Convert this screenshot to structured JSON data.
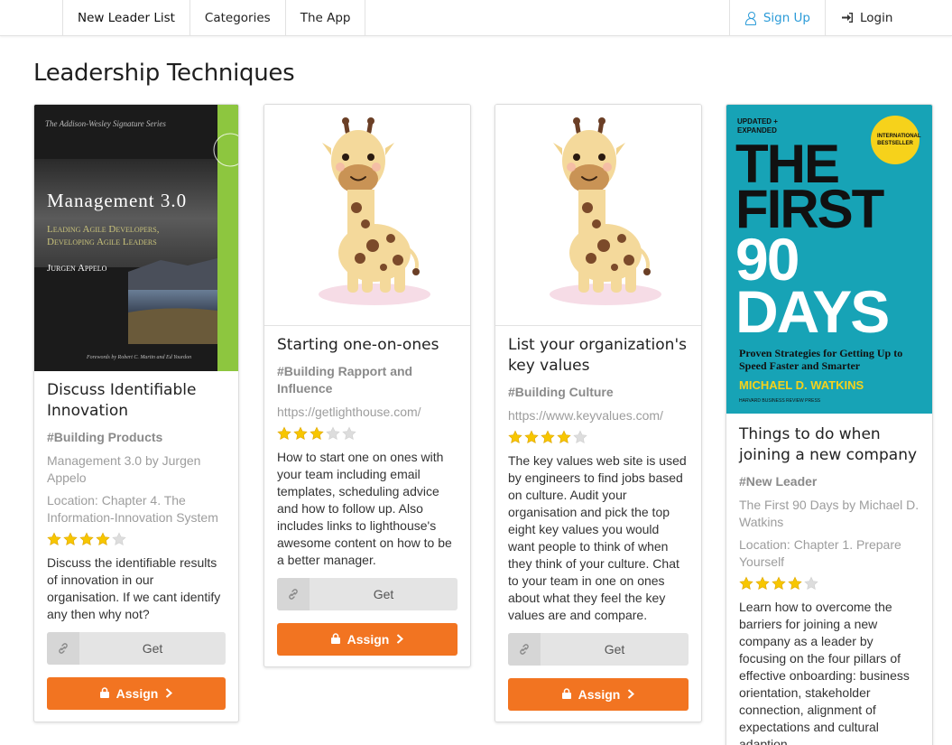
{
  "nav": {
    "items": [
      {
        "label": "New Leader List"
      },
      {
        "label": "Categories"
      },
      {
        "label": "The App"
      }
    ],
    "signup": "Sign Up",
    "login": "Login"
  },
  "page": {
    "title": "Leadership Techniques"
  },
  "cards": [
    {
      "title": "Discuss Identifiable Innovation",
      "tag": "#Building Products",
      "source": "Management 3.0  by Jurgen Appelo",
      "location": "Location: Chapter 4. The Information-Innovation System",
      "rating": 4,
      "description": "Discuss the identifiable results of innovation in our organisation. If we cant identify any then why not?",
      "get_label": "Get",
      "assign_label": "Assign",
      "cover": {
        "series": "The Addison-Wesley Signature Series",
        "title": "Management 3.0",
        "subtitle_line1": "Leading Agile Developers,",
        "subtitle_line2": "Developing Agile Leaders",
        "author": "Jurgen Appelo",
        "foreword": "Forewords by Robert C. Martin and Ed Yourdon",
        "color_bg": "#1b1b1b",
        "color_accent": "#8dc63f"
      }
    },
    {
      "title": "Starting one-on-ones",
      "tag": "#Building Rapport and Influence",
      "url": "https://getlighthouse.com/",
      "rating": 3,
      "description": "How to start one on ones with your team including email templates, scheduling advice and how to follow up. Also includes links to lighthouse's awesome content on how to be a better manager.",
      "get_label": "Get",
      "assign_label": "Assign"
    },
    {
      "title": "List your organization's key values",
      "tag": "#Building Culture",
      "url": "https://www.keyvalues.com/",
      "rating": 4,
      "description": "The key values web site is used by engineers to find jobs based on culture. Audit your organisation and pick the top eight key values you would want people to think of when they think of your culture. Chat to your team in one on ones about what they feel the key values are and compare.",
      "get_label": "Get",
      "assign_label": "Assign"
    },
    {
      "title": "Things to do when joining a new company",
      "tag": "#New Leader",
      "source": "The First 90 Days  by Michael D. Watkins",
      "location": "Location: Chapter 1. Prepare Yourself",
      "rating": 4,
      "description": "Learn how to overcome the barriers for joining a new company as a leader by focusing on the four pillars of effective onboarding: business orientation, stakeholder connection, alignment of expectations and cultural adaption.",
      "cover": {
        "badge": "UPDATED + EXPANDED",
        "line1": "THE",
        "line2": "FIRST",
        "line3": "90",
        "line4": "DAYS",
        "seal": "INTERNATIONAL BESTSELLER",
        "subtitle": "Proven Strategies for Getting Up to Speed Faster and Smarter",
        "author": "MICHAEL D. WATKINS",
        "publisher": "HARVARD BUSINESS REVIEW PRESS",
        "color_bg": "#17a3b6",
        "color_author": "#f6d21b"
      }
    }
  ],
  "colors": {
    "accent": "#f27421",
    "link": "#2b9bd8",
    "star_on": "#f7c600",
    "star_off": "#dddddd"
  }
}
